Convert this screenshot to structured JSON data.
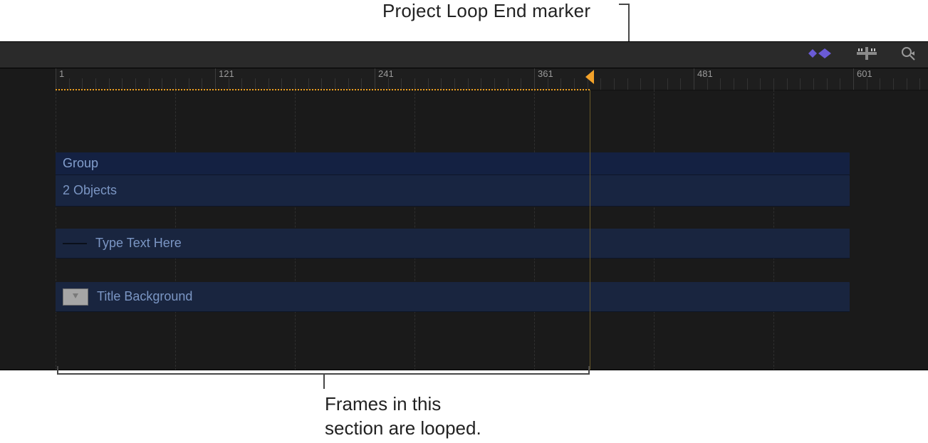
{
  "callouts": {
    "top": "Project Loop End marker",
    "bottom_line1": "Frames in this",
    "bottom_line2": "section are looped."
  },
  "toolbar": {
    "icon_keyframes": "keyframes-icon",
    "icon_snap": "snap-icon",
    "icon_zoom": "zoom-search-icon"
  },
  "ruler": {
    "labels": [
      "1",
      "121",
      "241",
      "361",
      "481",
      "601"
    ]
  },
  "timeline": {
    "loop_end_frame": 400,
    "playhead_frame": 400,
    "group_label": "Group",
    "group_sub": "2 Objects",
    "tracks": [
      {
        "label": "Type Text Here",
        "thumb": "line"
      },
      {
        "label": "Title Background",
        "thumb": "box"
      }
    ]
  }
}
